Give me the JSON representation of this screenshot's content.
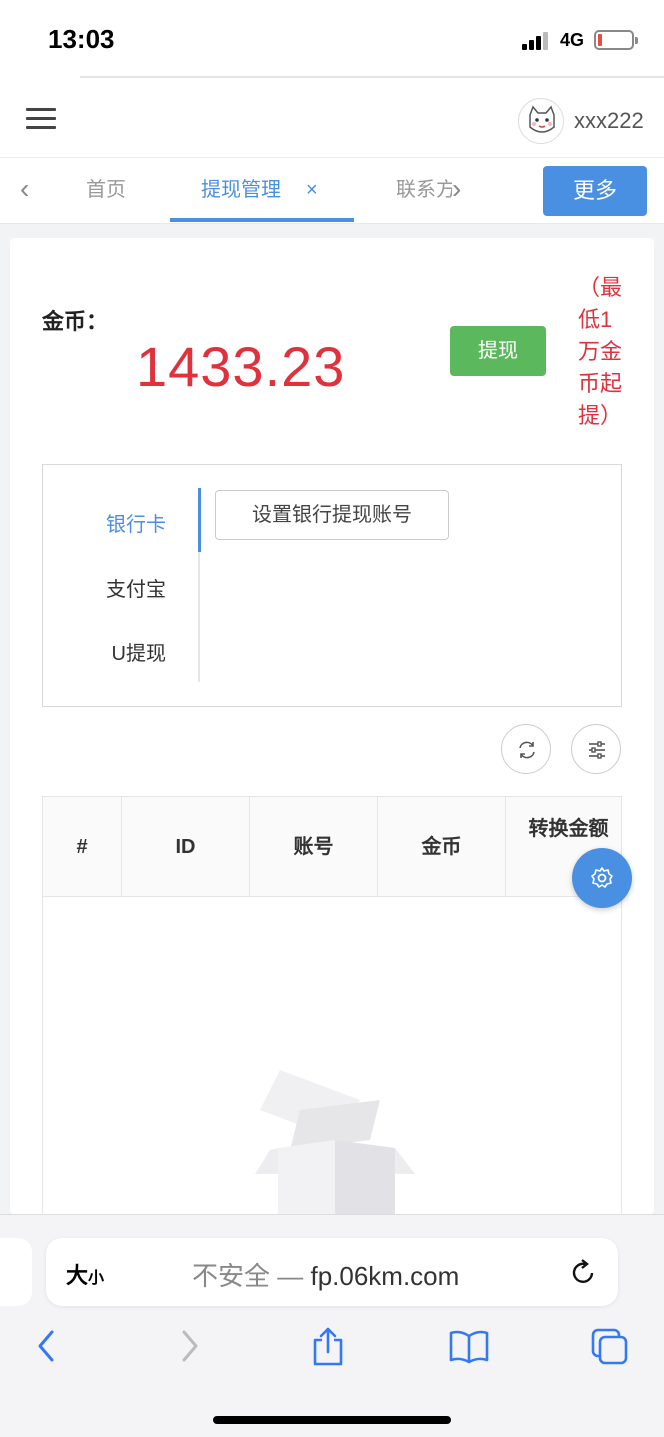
{
  "status_bar": {
    "time": "13:03",
    "network": "4G"
  },
  "header": {
    "username": "xxx222"
  },
  "tabs": {
    "items": [
      {
        "label": "首页"
      },
      {
        "label": "提现管理"
      },
      {
        "label": "联系方"
      }
    ],
    "active_index": 1,
    "close_symbol": "×",
    "more_label": "更多"
  },
  "balance": {
    "label": "金币：",
    "value": "1433.23",
    "withdraw_label": "提现",
    "min_note": "（最低1万金币起提）"
  },
  "methods": {
    "items": [
      {
        "label": "银行卡"
      },
      {
        "label": "支付宝"
      },
      {
        "label": "U提现"
      }
    ],
    "active_index": 0,
    "set_account_label": "设置银行提现账号"
  },
  "table": {
    "columns": [
      "#",
      "ID",
      "账号",
      "金币",
      "转换金额"
    ],
    "rows": []
  },
  "browser": {
    "text_size_big": "大",
    "text_size_small": "小",
    "insecure_label": "不安全 —",
    "domain": "fp.06km.com"
  },
  "colors": {
    "accent": "#4a90e2",
    "danger": "#e0323c",
    "success": "#5cb85c"
  }
}
